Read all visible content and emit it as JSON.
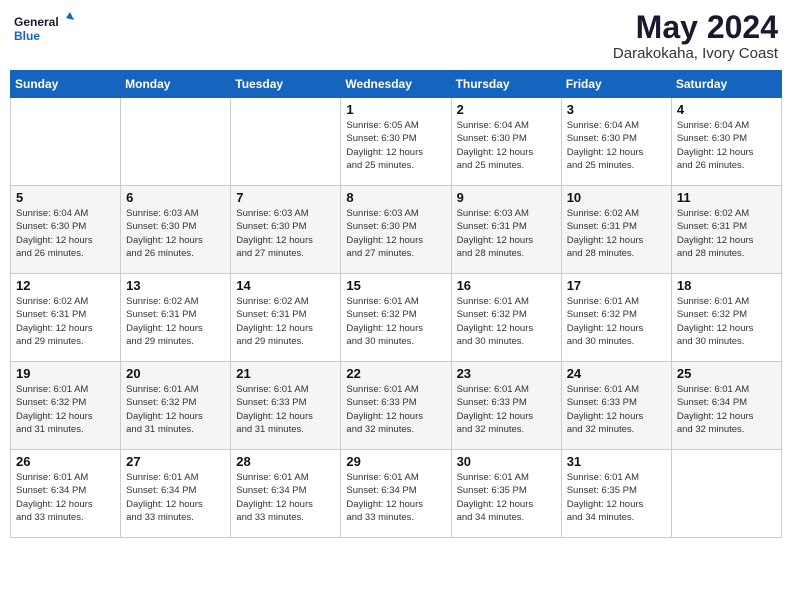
{
  "logo": {
    "line1": "General",
    "line2": "Blue"
  },
  "title": "May 2024",
  "location": "Darakokaha, Ivory Coast",
  "days_header": [
    "Sunday",
    "Monday",
    "Tuesday",
    "Wednesday",
    "Thursday",
    "Friday",
    "Saturday"
  ],
  "weeks": [
    [
      {
        "day": "",
        "info": ""
      },
      {
        "day": "",
        "info": ""
      },
      {
        "day": "",
        "info": ""
      },
      {
        "day": "1",
        "info": "Sunrise: 6:05 AM\nSunset: 6:30 PM\nDaylight: 12 hours\nand 25 minutes."
      },
      {
        "day": "2",
        "info": "Sunrise: 6:04 AM\nSunset: 6:30 PM\nDaylight: 12 hours\nand 25 minutes."
      },
      {
        "day": "3",
        "info": "Sunrise: 6:04 AM\nSunset: 6:30 PM\nDaylight: 12 hours\nand 25 minutes."
      },
      {
        "day": "4",
        "info": "Sunrise: 6:04 AM\nSunset: 6:30 PM\nDaylight: 12 hours\nand 26 minutes."
      }
    ],
    [
      {
        "day": "5",
        "info": "Sunrise: 6:04 AM\nSunset: 6:30 PM\nDaylight: 12 hours\nand 26 minutes."
      },
      {
        "day": "6",
        "info": "Sunrise: 6:03 AM\nSunset: 6:30 PM\nDaylight: 12 hours\nand 26 minutes."
      },
      {
        "day": "7",
        "info": "Sunrise: 6:03 AM\nSunset: 6:30 PM\nDaylight: 12 hours\nand 27 minutes."
      },
      {
        "day": "8",
        "info": "Sunrise: 6:03 AM\nSunset: 6:30 PM\nDaylight: 12 hours\nand 27 minutes."
      },
      {
        "day": "9",
        "info": "Sunrise: 6:03 AM\nSunset: 6:31 PM\nDaylight: 12 hours\nand 28 minutes."
      },
      {
        "day": "10",
        "info": "Sunrise: 6:02 AM\nSunset: 6:31 PM\nDaylight: 12 hours\nand 28 minutes."
      },
      {
        "day": "11",
        "info": "Sunrise: 6:02 AM\nSunset: 6:31 PM\nDaylight: 12 hours\nand 28 minutes."
      }
    ],
    [
      {
        "day": "12",
        "info": "Sunrise: 6:02 AM\nSunset: 6:31 PM\nDaylight: 12 hours\nand 29 minutes."
      },
      {
        "day": "13",
        "info": "Sunrise: 6:02 AM\nSunset: 6:31 PM\nDaylight: 12 hours\nand 29 minutes."
      },
      {
        "day": "14",
        "info": "Sunrise: 6:02 AM\nSunset: 6:31 PM\nDaylight: 12 hours\nand 29 minutes."
      },
      {
        "day": "15",
        "info": "Sunrise: 6:01 AM\nSunset: 6:32 PM\nDaylight: 12 hours\nand 30 minutes."
      },
      {
        "day": "16",
        "info": "Sunrise: 6:01 AM\nSunset: 6:32 PM\nDaylight: 12 hours\nand 30 minutes."
      },
      {
        "day": "17",
        "info": "Sunrise: 6:01 AM\nSunset: 6:32 PM\nDaylight: 12 hours\nand 30 minutes."
      },
      {
        "day": "18",
        "info": "Sunrise: 6:01 AM\nSunset: 6:32 PM\nDaylight: 12 hours\nand 30 minutes."
      }
    ],
    [
      {
        "day": "19",
        "info": "Sunrise: 6:01 AM\nSunset: 6:32 PM\nDaylight: 12 hours\nand 31 minutes."
      },
      {
        "day": "20",
        "info": "Sunrise: 6:01 AM\nSunset: 6:32 PM\nDaylight: 12 hours\nand 31 minutes."
      },
      {
        "day": "21",
        "info": "Sunrise: 6:01 AM\nSunset: 6:33 PM\nDaylight: 12 hours\nand 31 minutes."
      },
      {
        "day": "22",
        "info": "Sunrise: 6:01 AM\nSunset: 6:33 PM\nDaylight: 12 hours\nand 32 minutes."
      },
      {
        "day": "23",
        "info": "Sunrise: 6:01 AM\nSunset: 6:33 PM\nDaylight: 12 hours\nand 32 minutes."
      },
      {
        "day": "24",
        "info": "Sunrise: 6:01 AM\nSunset: 6:33 PM\nDaylight: 12 hours\nand 32 minutes."
      },
      {
        "day": "25",
        "info": "Sunrise: 6:01 AM\nSunset: 6:34 PM\nDaylight: 12 hours\nand 32 minutes."
      }
    ],
    [
      {
        "day": "26",
        "info": "Sunrise: 6:01 AM\nSunset: 6:34 PM\nDaylight: 12 hours\nand 33 minutes."
      },
      {
        "day": "27",
        "info": "Sunrise: 6:01 AM\nSunset: 6:34 PM\nDaylight: 12 hours\nand 33 minutes."
      },
      {
        "day": "28",
        "info": "Sunrise: 6:01 AM\nSunset: 6:34 PM\nDaylight: 12 hours\nand 33 minutes."
      },
      {
        "day": "29",
        "info": "Sunrise: 6:01 AM\nSunset: 6:34 PM\nDaylight: 12 hours\nand 33 minutes."
      },
      {
        "day": "30",
        "info": "Sunrise: 6:01 AM\nSunset: 6:35 PM\nDaylight: 12 hours\nand 34 minutes."
      },
      {
        "day": "31",
        "info": "Sunrise: 6:01 AM\nSunset: 6:35 PM\nDaylight: 12 hours\nand 34 minutes."
      },
      {
        "day": "",
        "info": ""
      }
    ]
  ]
}
